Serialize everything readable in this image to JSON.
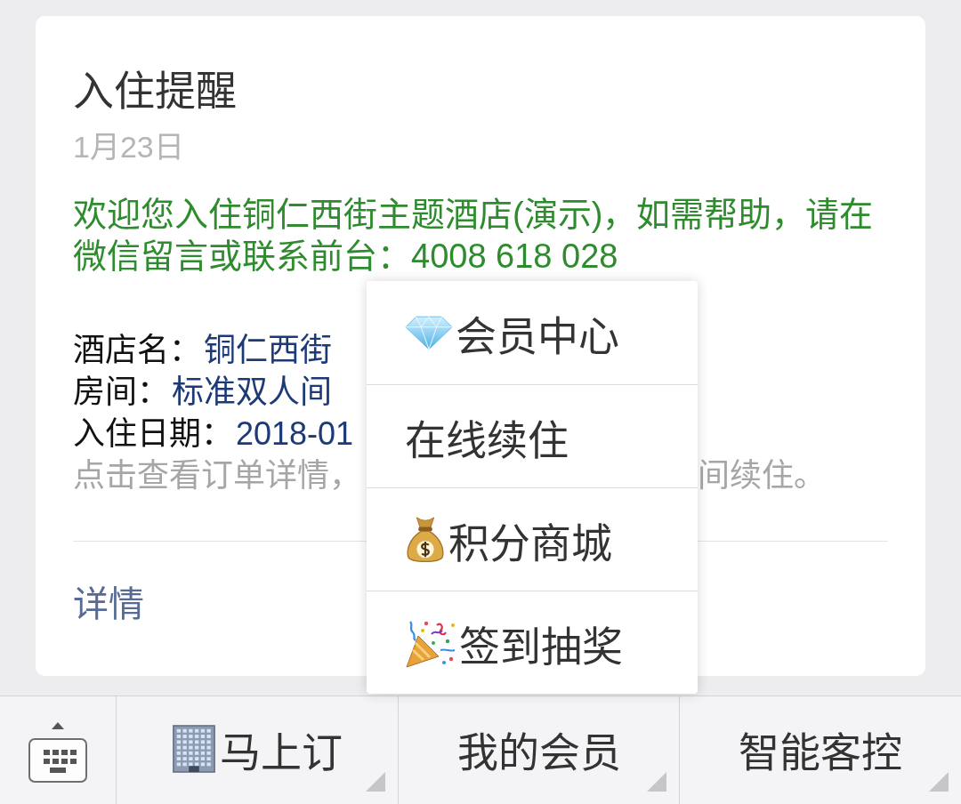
{
  "card": {
    "title": "入住提醒",
    "date": "1月23日",
    "message": "欢迎您入住铜仁西街主题酒店(演示)，如需帮助，请在微信留言或联系前台：4008 618 028",
    "fields": [
      {
        "label": "酒店名：",
        "value": "铜仁西街"
      },
      {
        "label": "房间：",
        "value": "标准双人间"
      },
      {
        "label": "入住日期：",
        "value": "2018-01"
      }
    ],
    "hint": {
      "start": "点击查看订单详情，",
      "end": "间续住。"
    },
    "link": "详情"
  },
  "popup_menu": {
    "items": [
      {
        "label": "会员中心"
      },
      {
        "label": "在线续住"
      },
      {
        "label": "积分商城"
      },
      {
        "label": "签到抽奖"
      }
    ]
  },
  "menu_bar": {
    "items": [
      {
        "label": "马上订",
        "submenu": true
      },
      {
        "label": "我的会员",
        "submenu": true
      },
      {
        "label": "智能客控",
        "submenu": true
      }
    ]
  }
}
